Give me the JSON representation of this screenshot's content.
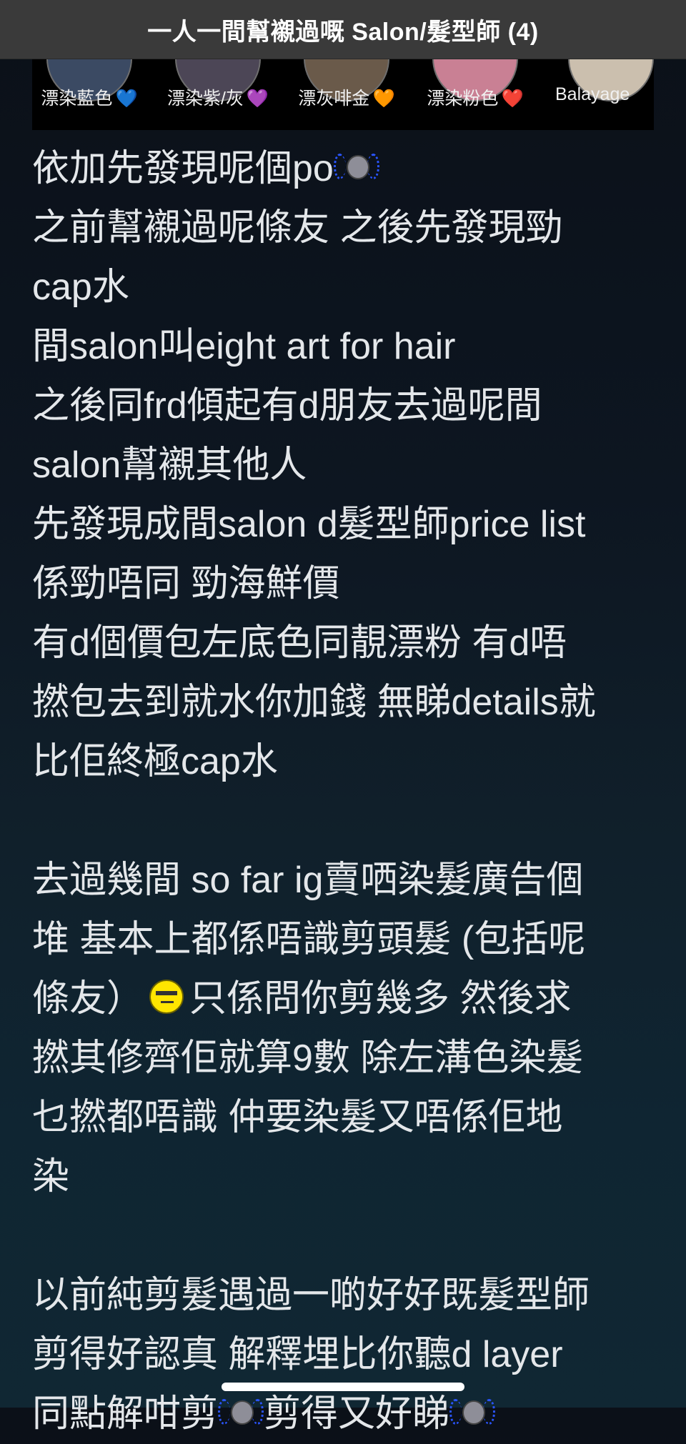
{
  "header": {
    "title": "一人一間幫襯過嘅 Salon/髮型師 (4)"
  },
  "color_strip": {
    "items": [
      {
        "label": "漂染藍色",
        "heart": "💙",
        "swatch_color": "#3b4a63"
      },
      {
        "label": "漂染紫/灰",
        "heart": "💜",
        "swatch_color": "#4c4656"
      },
      {
        "label": "漂灰啡金",
        "heart": "🧡",
        "swatch_color": "#6a5a4a"
      },
      {
        "label": "漂染粉色",
        "heart": "❤️",
        "swatch_color": "#c98094"
      },
      {
        "label": "Balayage",
        "heart": "",
        "swatch_color": "#cbbfae"
      }
    ]
  },
  "post": {
    "l1": "依加先發現呢個po",
    "l2": "之前幫襯過呢條友 之後先發現勁",
    "l3": "cap水",
    "l4": "間salon叫eight art for hair",
    "l5": "之後同frd傾起有d朋友去過呢間",
    "l6": "salon幫襯其他人",
    "l7": "先發現成間salon d髮型師price list",
    "l8": "係勁唔同 勁海鮮價",
    "l9": "有d個價包左底色同靚漂粉 有d唔",
    "l10": "撚包去到就水你加錢 無睇details就",
    "l11": "比佢終極cap水",
    "l12": "去過幾間 so far ig賣哂染髮廣告個",
    "l13": "堆 基本上都係唔識剪頭髮 (包括呢",
    "l14a": "條友）",
    "l14b": "只係問你剪幾多 然後求",
    "l15": "撚其修齊佢就算9數 除左溝色染髮",
    "l16": "乜撚都唔識 仲要染髮又唔係佢地",
    "l17": "染",
    "l18": "以前純剪髮遇過一啲好好既髮型師",
    "l19": "剪得好認真 解釋埋比你聽d layer",
    "l20a": "同點解咁剪",
    "l20b": "剪得又好睇"
  }
}
